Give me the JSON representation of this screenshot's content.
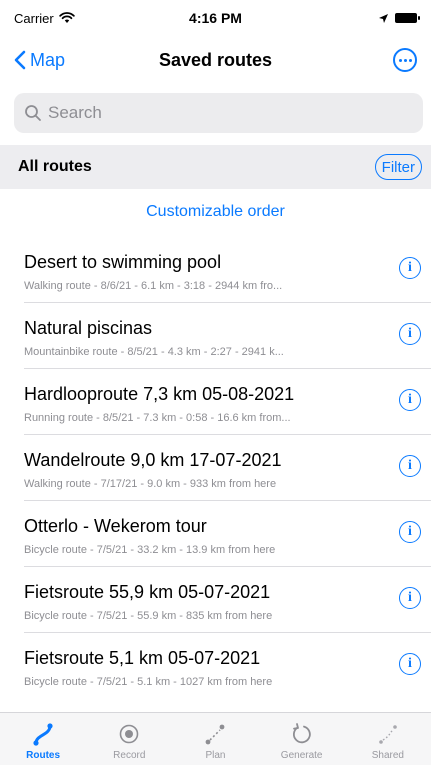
{
  "status_bar": {
    "carrier": "Carrier",
    "time": "4:16 PM"
  },
  "nav": {
    "back_label": "Map",
    "title": "Saved routes"
  },
  "search": {
    "placeholder": "Search"
  },
  "section": {
    "title": "All routes",
    "filter_label": "Filter"
  },
  "custom_order_label": "Customizable order",
  "routes": [
    {
      "title": "Desert to swimming pool",
      "subtitle": "Walking route - 8/6/21 - 6.1 km - 3:18 - 2944 km fro..."
    },
    {
      "title": "Natural piscinas",
      "subtitle": "Mountainbike route - 8/5/21 - 4.3 km - 2:27 - 2941 k..."
    },
    {
      "title": "Hardlooproute 7,3 km 05-08-2021",
      "subtitle": "Running route - 8/5/21 - 7.3 km - 0:58 - 16.6 km from..."
    },
    {
      "title": "Wandelroute 9,0 km 17-07-2021",
      "subtitle": "Walking route - 7/17/21 - 9.0 km - 933 km from here"
    },
    {
      "title": "Otterlo - Wekerom tour",
      "subtitle": "Bicycle route - 7/5/21 - 33.2 km - 13.9 km from here"
    },
    {
      "title": "Fietsroute 55,9 km 05-07-2021",
      "subtitle": "Bicycle route - 7/5/21 - 55.9 km - 835 km from here"
    },
    {
      "title": "Fietsroute 5,1 km 05-07-2021",
      "subtitle": "Bicycle route - 7/5/21 - 5.1 km - 1027 km from here"
    }
  ],
  "tabs": [
    {
      "label": "Routes",
      "icon": "route-icon",
      "active": true
    },
    {
      "label": "Record",
      "icon": "record-icon",
      "active": false
    },
    {
      "label": "Plan",
      "icon": "plan-icon",
      "active": false
    },
    {
      "label": "Generate",
      "icon": "generate-icon",
      "active": false
    },
    {
      "label": "Shared",
      "icon": "shared-icon",
      "active": false
    }
  ],
  "colors": {
    "accent": "#0a7aff",
    "secondary_text": "#8e8e93",
    "section_bg": "#ededf0"
  }
}
